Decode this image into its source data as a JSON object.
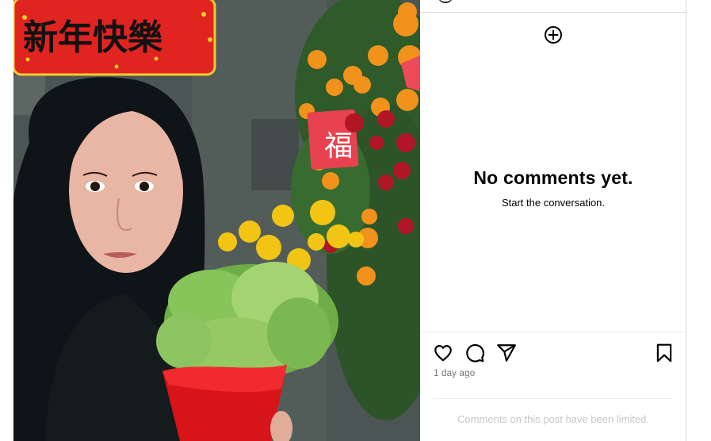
{
  "post": {
    "photo": {
      "icon": "post-photo-woman-with-lettuce-and-flowers",
      "banner_text": "新年快樂",
      "banner_color": "#e02420",
      "banner_text_color": "#111111"
    },
    "comments": {
      "empty_title": "No comments yet.",
      "empty_subtitle": "Start the conversation.",
      "add_icon": "plus-circle-icon"
    },
    "actions": {
      "like_icon": "heart-icon",
      "comment_icon": "comment-bubble-icon",
      "share_icon": "paper-plane-icon",
      "save_icon": "bookmark-icon"
    },
    "timestamp": "1 day ago",
    "limited_notice": "Comments on this post have been limited."
  },
  "colors": {
    "text_primary": "#000000",
    "text_secondary": "#737373",
    "text_muted": "#c7c7c7",
    "divider": "#dbdbdb"
  }
}
